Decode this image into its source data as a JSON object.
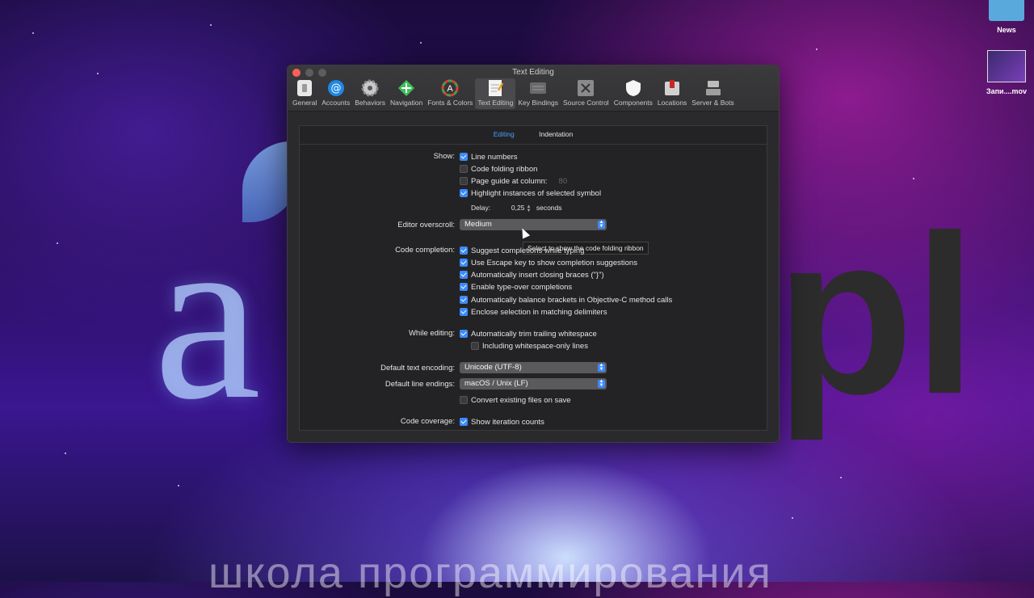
{
  "window": {
    "title": "Text Editing"
  },
  "toolbar": {
    "items": [
      {
        "label": "General"
      },
      {
        "label": "Accounts"
      },
      {
        "label": "Behaviors"
      },
      {
        "label": "Navigation"
      },
      {
        "label": "Fonts & Colors"
      },
      {
        "label": "Text Editing"
      },
      {
        "label": "Key Bindings"
      },
      {
        "label": "Source Control"
      },
      {
        "label": "Components"
      },
      {
        "label": "Locations"
      },
      {
        "label": "Server & Bots"
      }
    ]
  },
  "tabs": [
    {
      "label": "Editing"
    },
    {
      "label": "Indentation"
    }
  ],
  "show": {
    "label": "Show:",
    "line_numbers": "Line numbers",
    "code_folding": "Code folding ribbon",
    "page_guide": "Page guide at column:",
    "page_guide_value": "80",
    "highlight": "Highlight instances of selected symbol",
    "delay_label": "Delay:",
    "delay_value": "0,25",
    "delay_unit": "seconds"
  },
  "tooltip": "Select to show the code folding ribbon",
  "overscroll": {
    "label": "Editor overscroll:",
    "value": "Medium"
  },
  "completion": {
    "label": "Code completion:",
    "items": [
      "Suggest completions while typing",
      "Use Escape key to show completion suggestions",
      "Automatically insert closing braces (\"}\")",
      "Enable type-over completions",
      "Automatically balance brackets in Objective-C method calls",
      "Enclose selection in matching delimiters"
    ]
  },
  "while_editing": {
    "label": "While editing:",
    "trim": "Automatically trim trailing whitespace",
    "including": "Including whitespace-only lines"
  },
  "encoding": {
    "label": "Default text encoding:",
    "value": "Unicode (UTF-8)"
  },
  "line_endings": {
    "label": "Default line endings:",
    "value": "macOS / Unix (LF)",
    "convert": "Convert existing files on save"
  },
  "coverage": {
    "label": "Code coverage:",
    "value": "Show iteration counts"
  },
  "desktop": {
    "news": "News",
    "file": "Запи....mov",
    "bottom_text": "школа программирования"
  },
  "colors": {
    "accent": "#3d8bfd",
    "window_bg": "#2a2a2c"
  }
}
